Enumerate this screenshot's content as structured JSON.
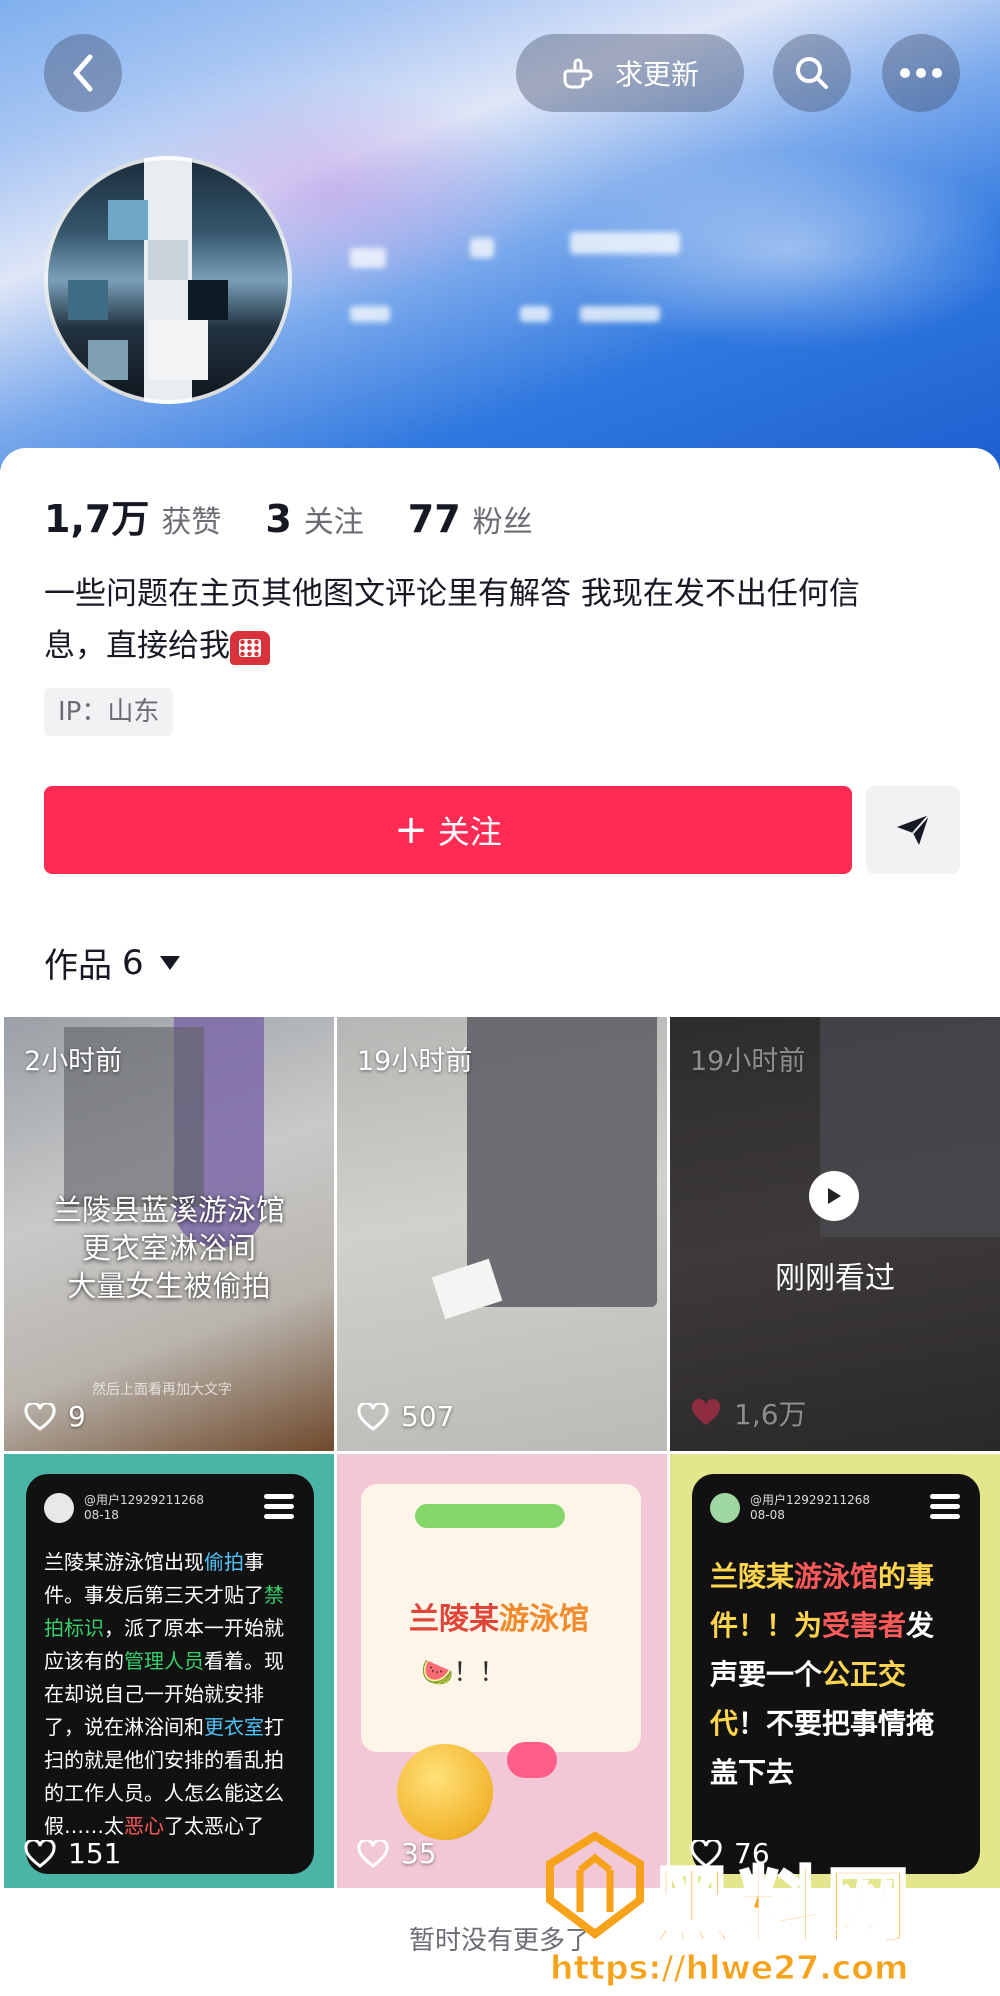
{
  "header": {
    "request_update_label": "求更新",
    "icons": [
      "back-icon",
      "hand-point-icon",
      "search-icon",
      "more-icon"
    ]
  },
  "profile": {
    "stats": [
      {
        "value": "1,7万",
        "label": "获赞"
      },
      {
        "value": "3",
        "label": "关注"
      },
      {
        "value": "77",
        "label": "粉丝"
      }
    ],
    "bio_line1": "一些问题在主页其他图文评论里有解答 我现在发不出任何信",
    "bio_line2": "息，直接给我",
    "ip": "IP：山东",
    "follow_label": "关注",
    "follow_plus": "+"
  },
  "works": {
    "tab_label": "作品",
    "count": "6",
    "tiles": [
      {
        "time": "2小时前",
        "likes": "9",
        "caption": [
          "兰陵县蓝溪游泳馆",
          "更衣室淋浴间",
          "大量女生被偷拍"
        ],
        "sub": "然后上面看再加大文字"
      },
      {
        "time": "19小时前",
        "likes": "507"
      },
      {
        "time": "19小时前",
        "likes": "1,6万",
        "seen_label": "刚刚看过"
      },
      {
        "likes": "151",
        "user": "@用户12929211268",
        "date": "08-18",
        "text": [
          {
            "t": "兰陵某游泳馆出现",
            "c": ""
          },
          {
            "t": "偷拍",
            "c": "b"
          },
          {
            "t": "事件。事发后第三天才贴了",
            "c": ""
          },
          {
            "t": "禁拍标识",
            "c": "g"
          },
          {
            "t": "，派了原本一开始就应该有的",
            "c": ""
          },
          {
            "t": "管理人员",
            "c": "g"
          },
          {
            "t": "看着。现在却说自己一开始就安排了，说在淋浴间和",
            "c": ""
          },
          {
            "t": "更衣室",
            "c": "b"
          },
          {
            "t": "打扫的就是他们安排的看乱拍的工作人员。人怎么能这么假……太",
            "c": ""
          },
          {
            "t": "恶心",
            "c": "r"
          },
          {
            "t": "了太恶心了",
            "c": ""
          }
        ]
      },
      {
        "likes": "35",
        "title_part1": "兰陵某",
        "title_part2": "游泳馆",
        "exclaim": "🍉！！"
      },
      {
        "likes": "76",
        "user": "@用户12929211268",
        "date": "08-08",
        "text": [
          {
            "t": "兰陵某",
            "c": "y"
          },
          {
            "t": "游泳馆",
            "c": "r"
          },
          {
            "t": "的事件！！为",
            "c": "y"
          },
          {
            "t": "受害者",
            "c": "r"
          },
          {
            "t": "发声要一个",
            "c": ""
          },
          {
            "t": "公正交代",
            "c": "y"
          },
          {
            "t": "！不要把事情掩盖下去",
            "c": ""
          }
        ]
      }
    ]
  },
  "footer": {
    "no_more": "暂时没有更多了"
  },
  "watermark": {
    "title": "黑料网",
    "url": "https://hlwe27.com"
  },
  "colors": {
    "accent": "#fe2c55",
    "watermark": "#f7a21b"
  }
}
